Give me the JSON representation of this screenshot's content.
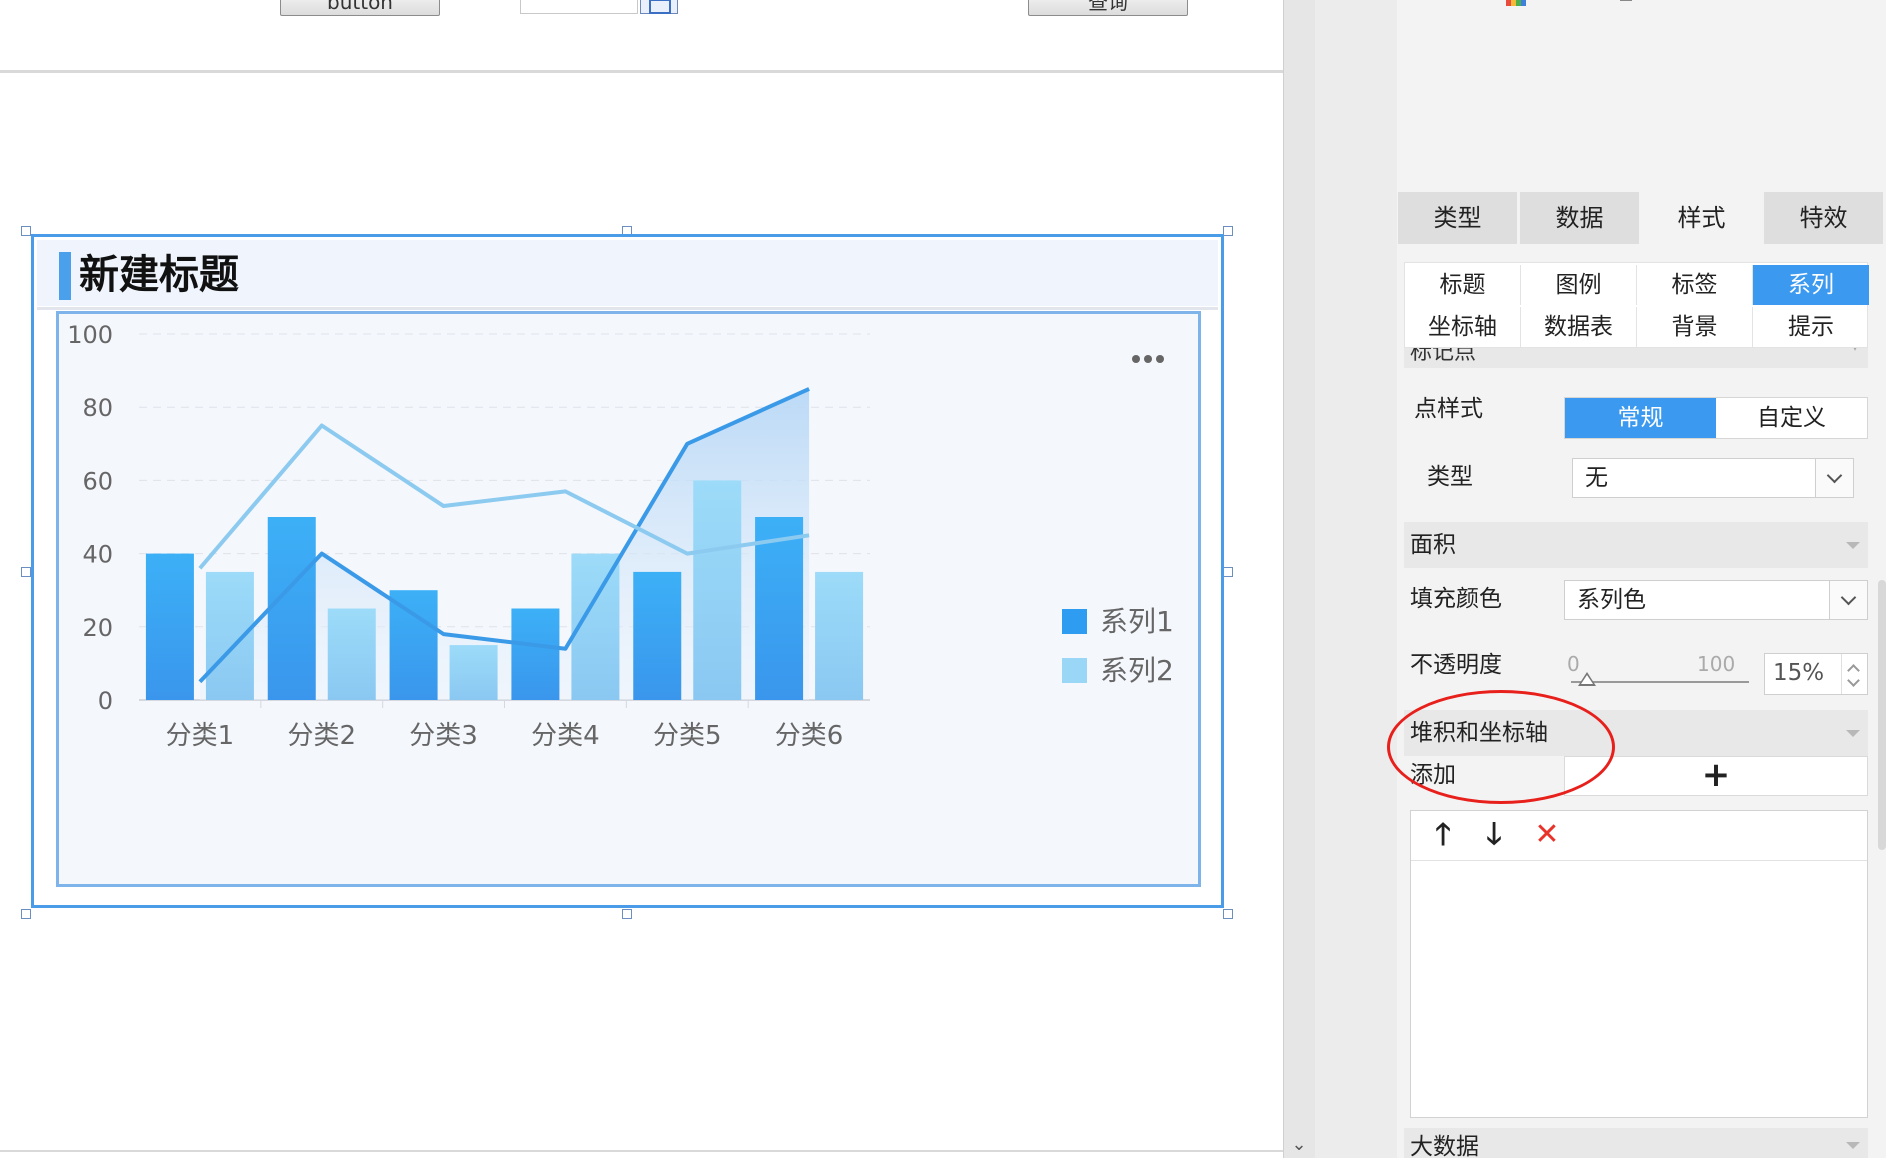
{
  "toolbar": {
    "button1_label": "button",
    "button2_label": "查询"
  },
  "widget": {
    "title": "新建标题"
  },
  "chart_data": {
    "type": "bar",
    "title": "",
    "categories": [
      "分类1",
      "分类2",
      "分类3",
      "分类4",
      "分类5",
      "分类6"
    ],
    "bar_series": [
      {
        "name": "系列1",
        "values": [
          40,
          50,
          30,
          25,
          35,
          50
        ],
        "color": "#3aa7f4"
      },
      {
        "name": "系列2",
        "values": [
          35,
          25,
          15,
          40,
          60,
          35
        ],
        "color": "#8ed3f7"
      }
    ],
    "line_series": [
      {
        "name": "系列1",
        "values": [
          5,
          40,
          18,
          14,
          70,
          85
        ],
        "color": "#3a9ae8",
        "area": true
      },
      {
        "name": "系列2",
        "values": [
          36,
          75,
          53,
          57,
          40,
          45
        ],
        "color": "#8ccaf0",
        "area": false
      }
    ],
    "yticks": [
      0,
      20,
      40,
      60,
      80,
      100
    ],
    "ylim": [
      0,
      100
    ],
    "grid": true,
    "legend": "right",
    "legend_colors": [
      "#2e9cf0",
      "#9ad6f6"
    ],
    "menu_icon": "more-dots-icon"
  },
  "panel": {
    "main_tabs": [
      {
        "label": "类型",
        "active": false
      },
      {
        "label": "数据",
        "active": false
      },
      {
        "label": "样式",
        "active": true
      },
      {
        "label": "特效",
        "active": false
      }
    ],
    "sub_tabs": [
      {
        "label": "标题",
        "active": false
      },
      {
        "label": "图例",
        "active": false
      },
      {
        "label": "标签",
        "active": false
      },
      {
        "label": "系列",
        "active": true
      },
      {
        "label": "坐标轴",
        "active": false
      },
      {
        "label": "数据表",
        "active": false
      },
      {
        "label": "背景",
        "active": false
      },
      {
        "label": "提示",
        "active": false
      }
    ],
    "cut_section": "标记点",
    "point_style": {
      "label": "点样式",
      "options": [
        "常规",
        "自定义"
      ],
      "selected": "常规"
    },
    "type": {
      "label": "类型",
      "value": "无"
    },
    "area_section": "面积",
    "fill_color": {
      "label": "填充颜色",
      "value": "系列色"
    },
    "opacity": {
      "label": "不透明度",
      "min": "0",
      "max": "100",
      "value": "15%"
    },
    "stack_section": "堆积和坐标轴",
    "add": {
      "label": "添加",
      "button": "+"
    },
    "list_tools": {
      "up": "🡑",
      "down": "🡓",
      "delete": "✕"
    },
    "bottom_section": "大数据"
  }
}
